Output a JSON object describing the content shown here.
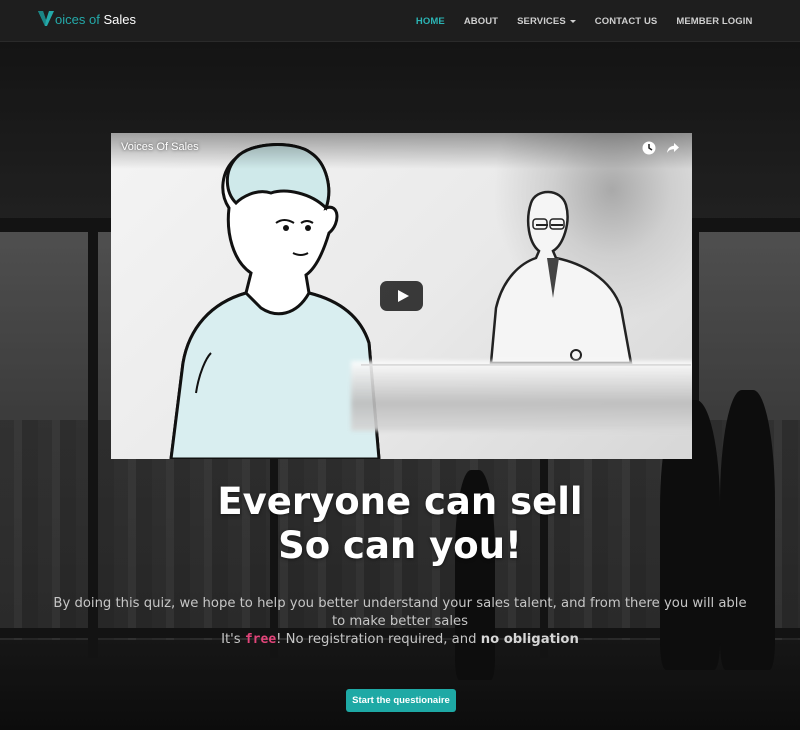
{
  "brand": {
    "logo_icon": "v-logo-icon",
    "text_voices": "oices of",
    "text_sales": "Sales",
    "accent_color": "#24a9a9"
  },
  "nav": {
    "items": [
      {
        "label": "HOME",
        "active": true
      },
      {
        "label": "ABOUT",
        "active": false
      },
      {
        "label": "SERVICES",
        "active": false,
        "dropdown": true
      },
      {
        "label": "CONTACT US",
        "active": false
      },
      {
        "label": "MEMBER LOGIN",
        "active": false
      }
    ]
  },
  "video": {
    "title": "Voices Of Sales",
    "icons": [
      "watch-later-icon",
      "share-icon",
      "play-icon"
    ]
  },
  "hero": {
    "title_line1": "Everyone can sell",
    "title_line2": "So can you!",
    "subtitle_line1": "By doing this quiz, we hope to help you better understand your sales talent, and from there you will able to make better sales",
    "subtitle_prefix": "It's ",
    "subtitle_free": "free",
    "subtitle_middle": "! No registration required, and ",
    "subtitle_bold": "no obligation"
  },
  "cta": {
    "label": "Start the questionaire",
    "color": "#1ea9a5"
  },
  "colors": {
    "free_highlight": "#e2457a",
    "nav_active": "#2bb4b4"
  }
}
